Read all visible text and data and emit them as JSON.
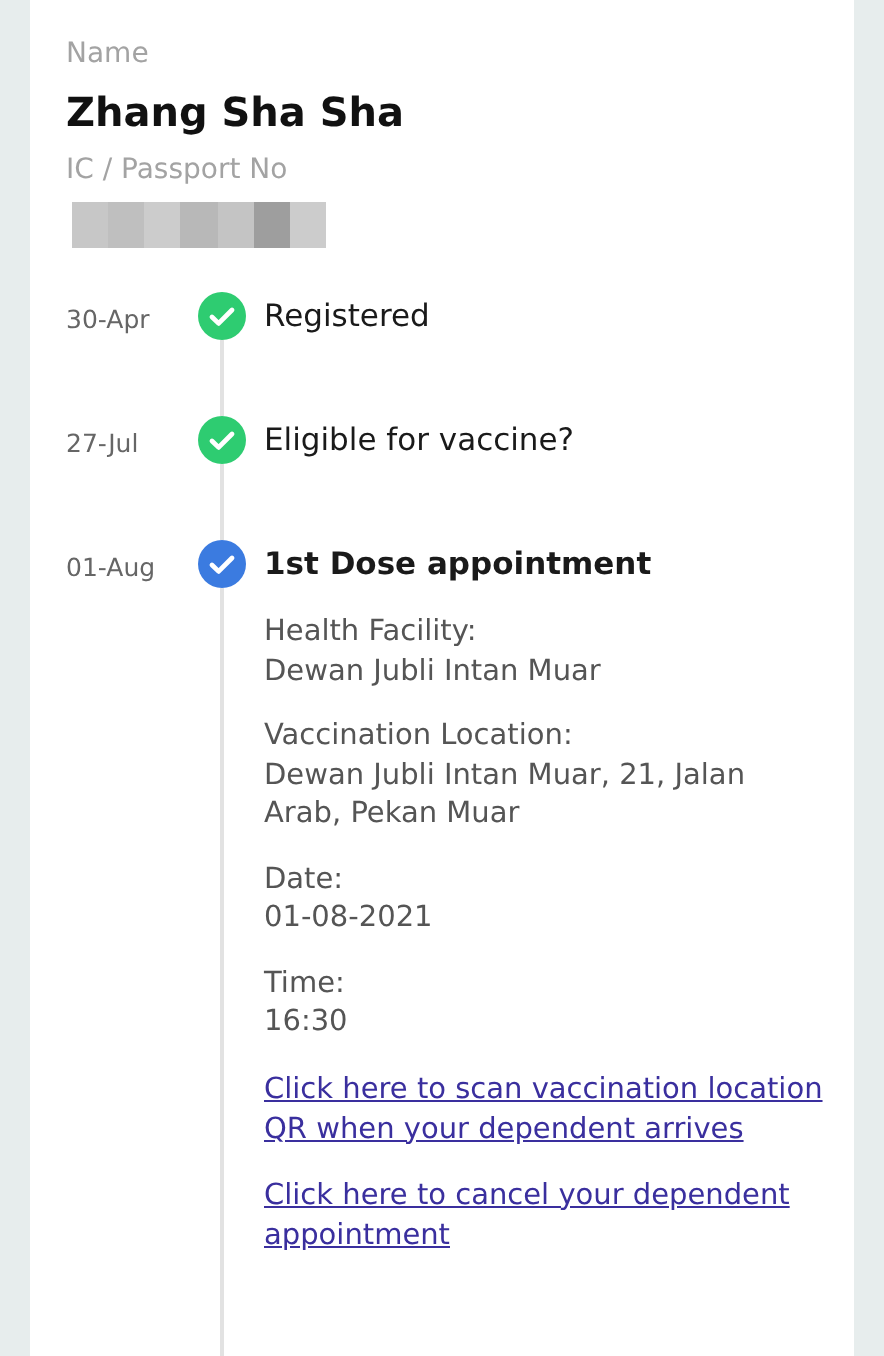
{
  "profile": {
    "name_label": "Name",
    "name": "Zhang Sha Sha",
    "id_label": "IC / Passport No"
  },
  "timeline": [
    {
      "date": "30-Apr",
      "title": "Registered",
      "kind": "done"
    },
    {
      "date": "27-Jul",
      "title": "Eligible for vaccine?",
      "kind": "done"
    },
    {
      "date": "01-Aug",
      "title": "1st Dose appointment",
      "kind": "current",
      "details": [
        {
          "label": "Health Facility:",
          "value": "Dewan Jubli Intan Muar"
        },
        {
          "label": "Vaccination Location:",
          "value": "Dewan Jubli Intan Muar, 21, Jalan Arab, Pekan Muar"
        },
        {
          "label": "Date:",
          "value": "01-08-2021"
        },
        {
          "label": "Time:",
          "value": "16:30"
        }
      ],
      "links": [
        "Click here to scan vaccination location QR when your dependent arrives",
        "Click here to cancel your dependent appointment"
      ]
    }
  ]
}
